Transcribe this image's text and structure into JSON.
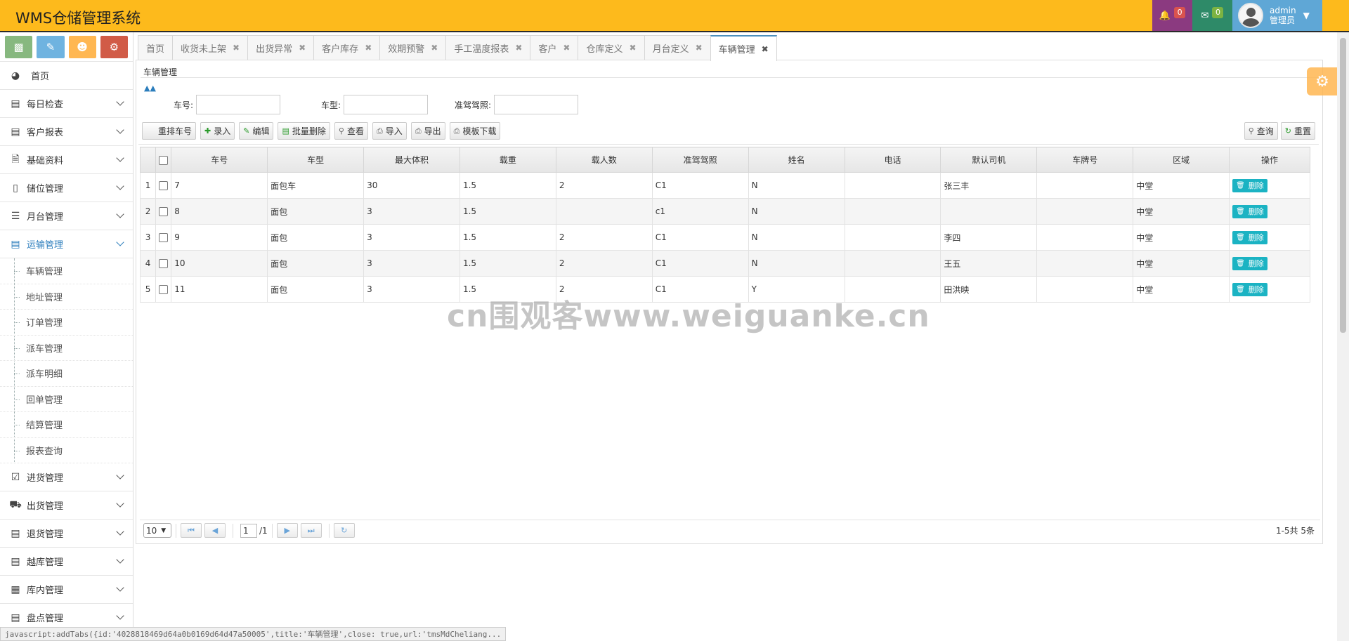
{
  "app": {
    "title": "WMS仓储管理系统",
    "header": {
      "bell_count": "0",
      "mail_count": "0",
      "user_name": "admin",
      "user_role": "管理员"
    }
  },
  "sidebar": {
    "home": "首页",
    "items": [
      {
        "label": "每日检查",
        "icon": "list-icon"
      },
      {
        "label": "客户报表",
        "icon": "list-icon"
      },
      {
        "label": "基础资料",
        "icon": "file-icon"
      },
      {
        "label": "储位管理",
        "icon": "mobile-icon"
      },
      {
        "label": "月台管理",
        "icon": "bulleted-list-icon"
      },
      {
        "label": "运输管理",
        "icon": "list-icon"
      }
    ],
    "transport_sub": [
      "车辆管理",
      "地址管理",
      "订单管理",
      "派车管理",
      "派车明细",
      "回单管理",
      "结算管理",
      "报表查询"
    ],
    "items_after": [
      {
        "label": "进货管理",
        "icon": "check-square-icon"
      },
      {
        "label": "出货管理",
        "icon": "truck-icon"
      },
      {
        "label": "退货管理",
        "icon": "list-icon"
      },
      {
        "label": "越库管理",
        "icon": "list-icon"
      },
      {
        "label": "库内管理",
        "icon": "film-icon"
      },
      {
        "label": "盘点管理",
        "icon": "list-icon"
      }
    ]
  },
  "tabs": [
    {
      "label": "首页",
      "closable": false
    },
    {
      "label": "收货未上架",
      "closable": true
    },
    {
      "label": "出货异常",
      "closable": true
    },
    {
      "label": "客户库存",
      "closable": true
    },
    {
      "label": "效期预警",
      "closable": true
    },
    {
      "label": "手工温度报表",
      "closable": true
    },
    {
      "label": "客户",
      "closable": true
    },
    {
      "label": "仓库定义",
      "closable": true
    },
    {
      "label": "月台定义",
      "closable": true
    },
    {
      "label": "车辆管理",
      "closable": true,
      "active": true
    }
  ],
  "page": {
    "breadcrumb": "车辆管理",
    "search": {
      "car_no_label": "车号:",
      "car_type_label": "车型:",
      "license_label": "准驾驾照:"
    },
    "toolbar": {
      "reorder": "重排车号",
      "add": "录入",
      "edit": "编辑",
      "batch_delete": "批量删除",
      "view": "查看",
      "import": "导入",
      "export": "导出",
      "template": "模板下载",
      "query": "查询",
      "reset": "重置"
    },
    "table": {
      "columns": [
        "车号",
        "车型",
        "最大体积",
        "载重",
        "载人数",
        "准驾驾照",
        "姓名",
        "电话",
        "默认司机",
        "车牌号",
        "区域",
        "操作"
      ],
      "delete_label": "删除",
      "rows": [
        {
          "n": "1",
          "car_no": "7",
          "type": "面包车",
          "volume": "30",
          "weight": "1.5",
          "seats": "2",
          "license": "C1",
          "name": "N",
          "phone": "",
          "driver": "张三丰",
          "plate": "",
          "area": "中堂"
        },
        {
          "n": "2",
          "car_no": "8",
          "type": "面包",
          "volume": "3",
          "weight": "1.5",
          "seats": "",
          "license": "c1",
          "name": "N",
          "phone": "",
          "driver": "",
          "plate": "",
          "area": "中堂"
        },
        {
          "n": "3",
          "car_no": "9",
          "type": "面包",
          "volume": "3",
          "weight": "1.5",
          "seats": "2",
          "license": "C1",
          "name": "N",
          "phone": "",
          "driver": "李四",
          "plate": "",
          "area": "中堂"
        },
        {
          "n": "4",
          "car_no": "10",
          "type": "面包",
          "volume": "3",
          "weight": "1.5",
          "seats": "2",
          "license": "C1",
          "name": "N",
          "phone": "",
          "driver": "王五",
          "plate": "",
          "area": "中堂"
        },
        {
          "n": "5",
          "car_no": "11",
          "type": "面包",
          "volume": "3",
          "weight": "1.5",
          "seats": "2",
          "license": "C1",
          "name": "Y",
          "phone": "",
          "driver": "田洪映",
          "plate": "",
          "area": "中堂"
        }
      ]
    },
    "pager": {
      "page_size": "10",
      "current_page": "1",
      "total_pages": "/1",
      "info": "1-5共 5条"
    }
  },
  "watermark": "cn围观客www.weiguanke.cn",
  "status_bar": "javascript:addTabs({id:'4028818469d64a0b0169d64d47a50005',title:'车辆管理',close: true,url:'tmsMdCheliang...",
  "colors": {
    "header_bg": "#FDBA1C",
    "bell_bg": "#8B3A80",
    "mail_bg": "#2E8A68",
    "user_bg": "#5FA7D6",
    "active_blue": "#2b7dbc",
    "delete_btn": "#1bb3c3"
  }
}
